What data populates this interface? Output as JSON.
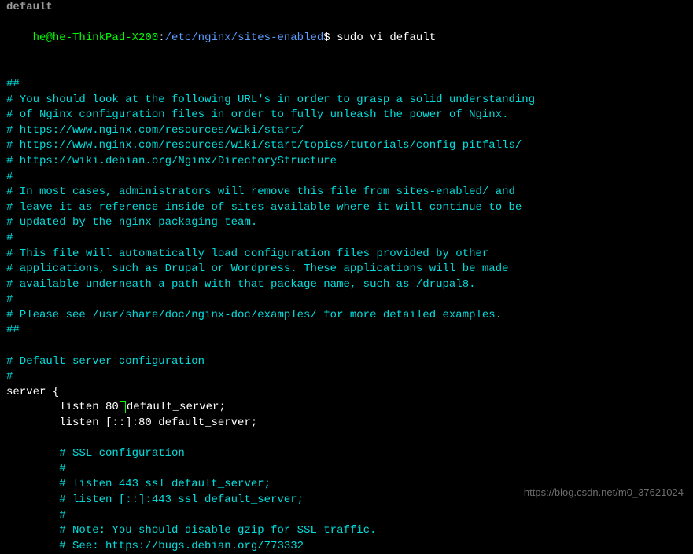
{
  "top_cut": "default",
  "prompt": {
    "user": "he@he-ThinkPad-X200",
    "separator": ":",
    "path": "/etc/nginx/sites-enabled",
    "dollar": "$",
    "command": "sudo vi default"
  },
  "file_content": {
    "lines": [
      {
        "type": "comment",
        "text": "##"
      },
      {
        "type": "comment",
        "text": "# You should look at the following URL's in order to grasp a solid understanding"
      },
      {
        "type": "comment",
        "text": "# of Nginx configuration files in order to fully unleash the power of Nginx."
      },
      {
        "type": "comment",
        "text": "# https://www.nginx.com/resources/wiki/start/"
      },
      {
        "type": "comment",
        "text": "# https://www.nginx.com/resources/wiki/start/topics/tutorials/config_pitfalls/"
      },
      {
        "type": "comment",
        "text": "# https://wiki.debian.org/Nginx/DirectoryStructure"
      },
      {
        "type": "comment",
        "text": "#"
      },
      {
        "type": "comment",
        "text": "# In most cases, administrators will remove this file from sites-enabled/ and"
      },
      {
        "type": "comment",
        "text": "# leave it as reference inside of sites-available where it will continue to be"
      },
      {
        "type": "comment",
        "text": "# updated by the nginx packaging team."
      },
      {
        "type": "comment",
        "text": "#"
      },
      {
        "type": "comment",
        "text": "# This file will automatically load configuration files provided by other"
      },
      {
        "type": "comment",
        "text": "# applications, such as Drupal or Wordpress. These applications will be made"
      },
      {
        "type": "comment",
        "text": "# available underneath a path with that package name, such as /drupal8."
      },
      {
        "type": "comment",
        "text": "#"
      },
      {
        "type": "comment",
        "text": "# Please see /usr/share/doc/nginx-doc/examples/ for more detailed examples."
      },
      {
        "type": "comment",
        "text": "##"
      },
      {
        "type": "blank",
        "text": ""
      },
      {
        "type": "comment",
        "text": "# Default server configuration"
      },
      {
        "type": "comment",
        "text": "#"
      },
      {
        "type": "directive",
        "text": "server {"
      },
      {
        "type": "listen_cursor",
        "prefix": "        listen 80",
        "suffix": "default_server;"
      },
      {
        "type": "directive",
        "text": "        listen [::]:80 default_server;"
      },
      {
        "type": "blank",
        "text": ""
      },
      {
        "type": "comment",
        "text": "        # SSL configuration"
      },
      {
        "type": "comment",
        "text": "        #"
      },
      {
        "type": "comment",
        "text": "        # listen 443 ssl default_server;"
      },
      {
        "type": "comment",
        "text": "        # listen [::]:443 ssl default_server;"
      },
      {
        "type": "comment",
        "text": "        #"
      },
      {
        "type": "comment",
        "text": "        # Note: You should disable gzip for SSL traffic."
      },
      {
        "type": "comment",
        "text": "        # See: https://bugs.debian.org/773332"
      }
    ]
  },
  "watermark": "https://blog.csdn.net/m0_37621024"
}
